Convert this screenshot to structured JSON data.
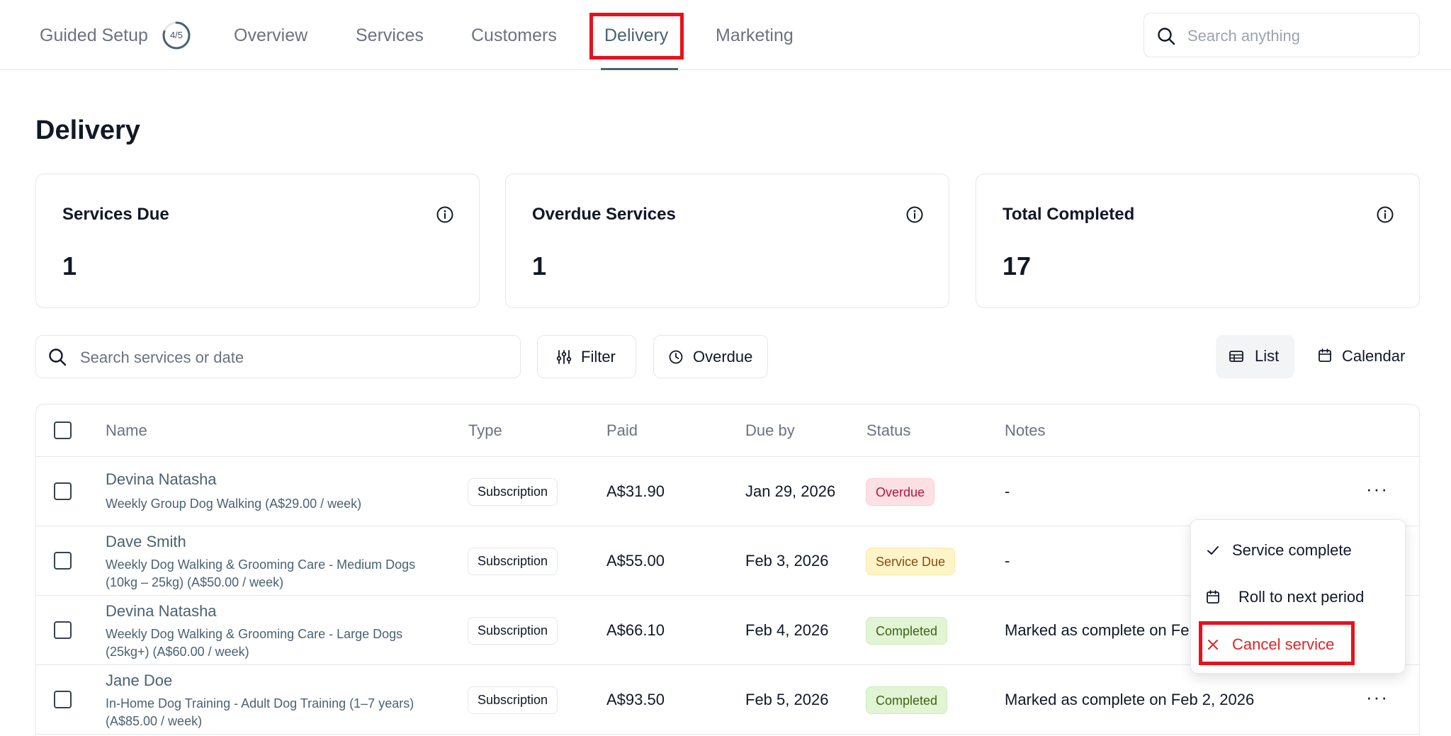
{
  "nav": {
    "guided_setup": "Guided Setup",
    "setup_progress": "4/5",
    "setup_fraction": 0.8,
    "items": [
      "Overview",
      "Services",
      "Customers",
      "Delivery",
      "Marketing"
    ],
    "active": "Delivery",
    "search_placeholder": "Search anything",
    "search_icon": "search-icon"
  },
  "page": {
    "title": "Delivery"
  },
  "stats": [
    {
      "label": "Services Due",
      "value": "1"
    },
    {
      "label": "Overdue Services",
      "value": "1"
    },
    {
      "label": "Total Completed",
      "value": "17"
    }
  ],
  "toolbar": {
    "search_placeholder": "Search services or date",
    "filter_label": "Filter",
    "overdue_label": "Overdue",
    "list_label": "List",
    "calendar_label": "Calendar"
  },
  "table": {
    "columns": [
      "Name",
      "Type",
      "Paid",
      "Due by",
      "Status",
      "Notes"
    ],
    "rows": [
      {
        "customer": "Devina Natasha",
        "service": "Weekly Group Dog Walking (A$29.00 / week)",
        "type": "Subscription",
        "paid": "A$31.90",
        "due": "Jan 29, 2026",
        "status": "Overdue",
        "notes": "-"
      },
      {
        "customer": "Dave Smith",
        "service": "Weekly Dog Walking & Grooming Care - Medium Dogs (10kg – 25kg) (A$50.00 / week)",
        "type": "Subscription",
        "paid": "A$55.00",
        "due": "Feb 3, 2026",
        "status": "Service Due",
        "notes": "-"
      },
      {
        "customer": "Devina Natasha",
        "service": "Weekly Dog Walking & Grooming Care - Large Dogs (25kg+) (A$60.00 / week)",
        "type": "Subscription",
        "paid": "A$66.10",
        "due": "Feb 4, 2026",
        "status": "Completed",
        "notes": "Marked as complete on Fe"
      },
      {
        "customer": "Jane Doe",
        "service": "In-Home Dog Training - Adult Dog Training (1–7 years) (A$85.00 / week)",
        "type": "Subscription",
        "paid": "A$93.50",
        "due": "Feb 5, 2026",
        "status": "Completed",
        "notes": "Marked as complete on Feb 2, 2026"
      }
    ],
    "row_menu_glyph": "···"
  },
  "row_menu": {
    "items": [
      {
        "label": "Service complete",
        "icon": "check-icon"
      },
      {
        "label": "Roll to next period",
        "icon": "calendar-icon"
      },
      {
        "label": "Cancel service",
        "icon": "x-icon"
      }
    ]
  },
  "colors": {
    "accent": "#4a6272",
    "highlight": "#e8111b",
    "danger": "#e02424"
  }
}
